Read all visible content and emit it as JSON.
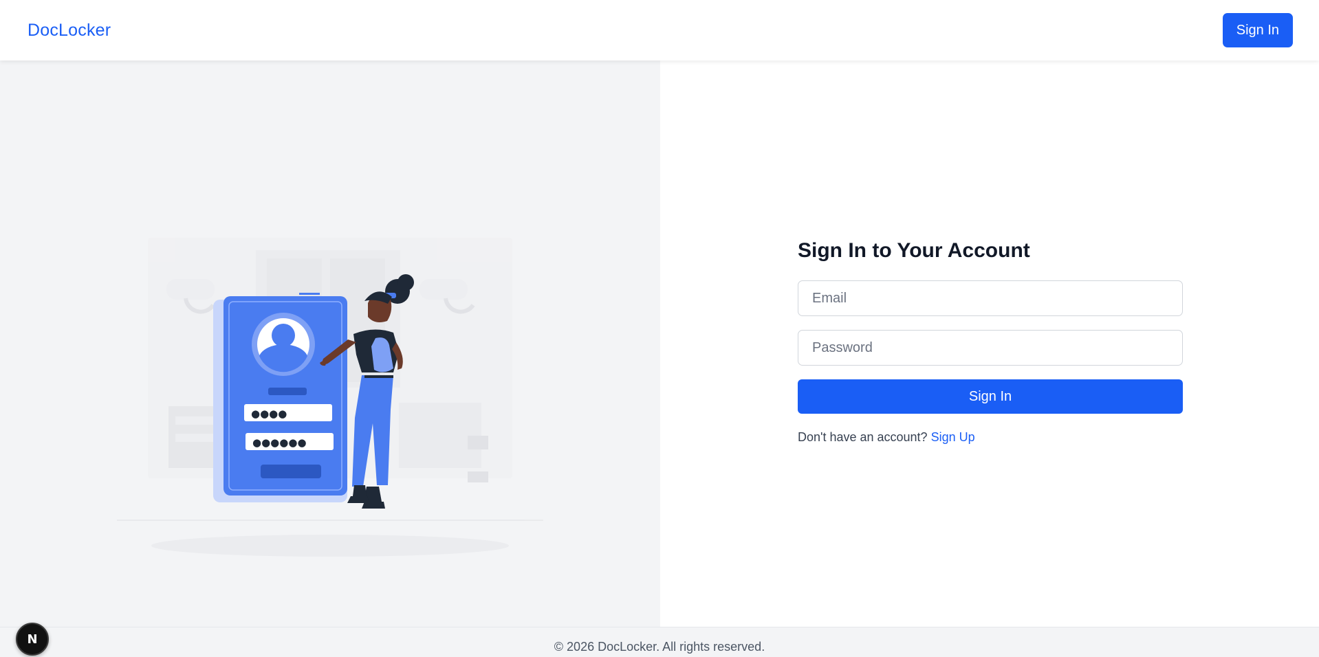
{
  "navbar": {
    "brand": "DocLocker",
    "signin_label": "Sign In"
  },
  "form": {
    "title": "Sign In to Your Account",
    "email_placeholder": "Email",
    "password_placeholder": "Password",
    "submit_label": "Sign In",
    "signup_prompt": "Don't have an account?",
    "signup_link": "Sign Up"
  },
  "footer": {
    "copyright": "© 2026 DocLocker. All rights reserved."
  },
  "dev_badge": {
    "letter": "N"
  },
  "illustration": {
    "pin_dots": "●●●●",
    "password_dots": "●●●●●●"
  },
  "colors": {
    "accent": "#1a5ef5",
    "illustration_blue": "#4a7cf0",
    "pane_gray": "#f3f4f6"
  },
  "icons": [
    "user-avatar-icon",
    "nextjs-logo-icon"
  ]
}
